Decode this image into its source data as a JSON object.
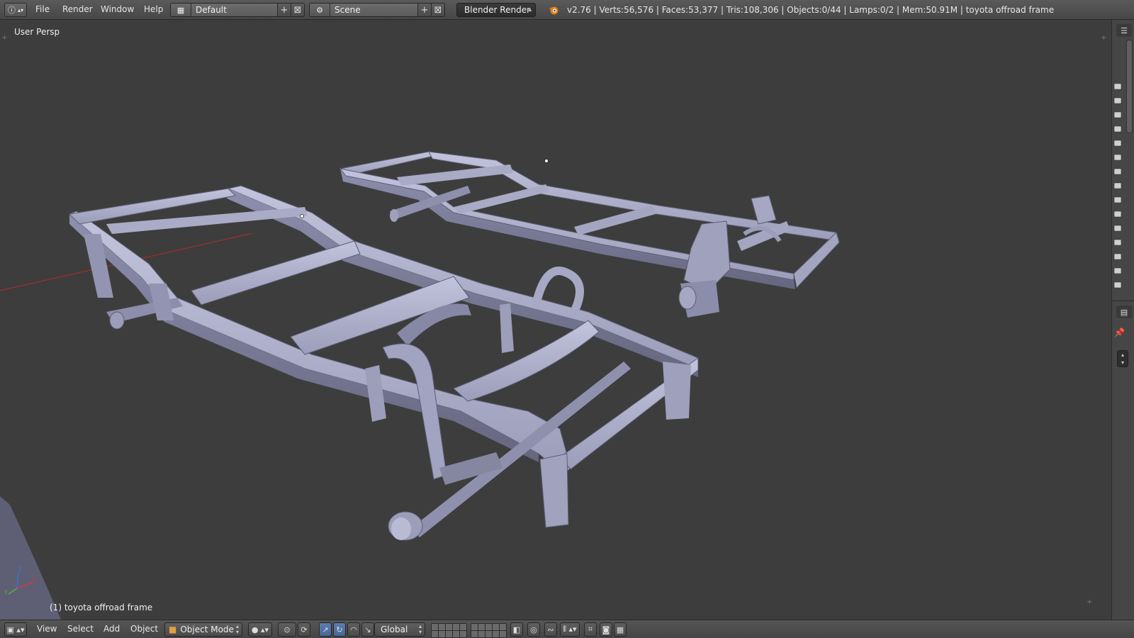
{
  "topbar": {
    "menus": [
      "File",
      "Render",
      "Window",
      "Help"
    ],
    "layout": {
      "name": "Default"
    },
    "scene": {
      "name": "Scene"
    },
    "render_engine": "Blender Render",
    "stats": "v2.76 | Verts:56,576 | Faces:53,377 | Tris:108,306 | Objects:0/44 | Lamps:0/2 | Mem:50.91M | toyota offroad frame"
  },
  "viewport": {
    "view_label": "User Persp",
    "object_label": "(1) toyota offroad frame",
    "axis": {
      "x": "X",
      "y": "Y",
      "z": "Z"
    }
  },
  "bottombar": {
    "menus": [
      "View",
      "Select",
      "Add",
      "Object"
    ],
    "mode": "Object Mode",
    "orientation": "Global"
  },
  "colors": {
    "viewport_bg": "#3d3d3d",
    "model_fill": "#9a9bb6",
    "model_shadow": "#6c6d88",
    "model_highlight": "#c4c5de",
    "accent_blue": "#5b7cb0",
    "axis_x": "#d03a3a",
    "axis_y": "#58b336",
    "axis_z": "#3f6fd6"
  },
  "icons": {
    "info": "info-icon",
    "screen_layout": "screen-layout-icon",
    "scene": "scene-icon",
    "blender": "blender-logo-icon",
    "camera": "camera-icon",
    "editor_type": "3d-view-icon"
  }
}
